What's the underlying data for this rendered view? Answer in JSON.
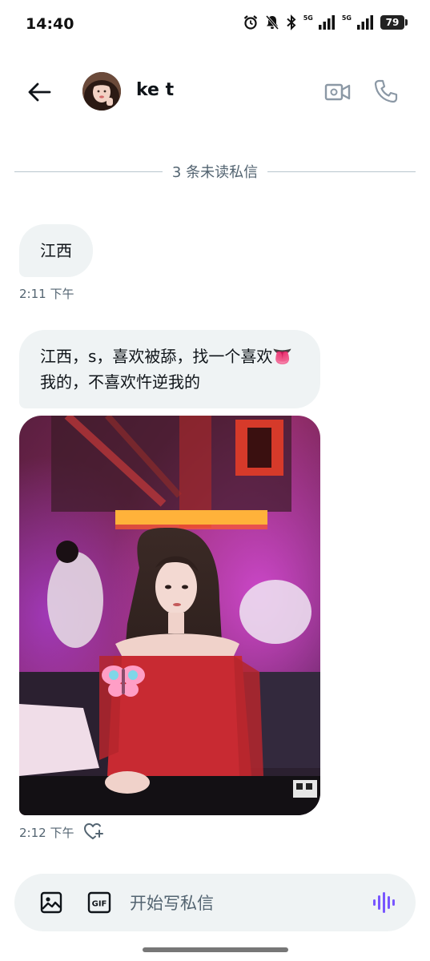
{
  "status_bar": {
    "time": "14:40",
    "network_label_1": "5G",
    "network_label_2": "5G",
    "battery": "79",
    "icons": [
      "alarm-icon",
      "bell-off-icon",
      "bluetooth-icon",
      "signal-icon",
      "signal-icon"
    ]
  },
  "header": {
    "back_icon": "arrow-left-icon",
    "contact_name": "ke t",
    "video_icon": "video-camera-icon",
    "call_icon": "phone-icon"
  },
  "conversation": {
    "unread_divider": "3 条未读私信",
    "messages": [
      {
        "text": "江西",
        "time": "2:11 下午"
      },
      {
        "text": "江西，s，喜欢被舔，找一个喜欢👅我的，不喜欢忤逆我的"
      },
      {
        "type": "image",
        "time": "2:12 下午"
      }
    ]
  },
  "compose": {
    "placeholder": "开始写私信",
    "image_icon": "image-icon",
    "gif_label": "GIF",
    "voice_icon": "voice-wave-icon"
  },
  "colors": {
    "bubble_bg": "#eff3f4",
    "secondary_text": "#536471",
    "voice_accent": "#7856ff"
  }
}
